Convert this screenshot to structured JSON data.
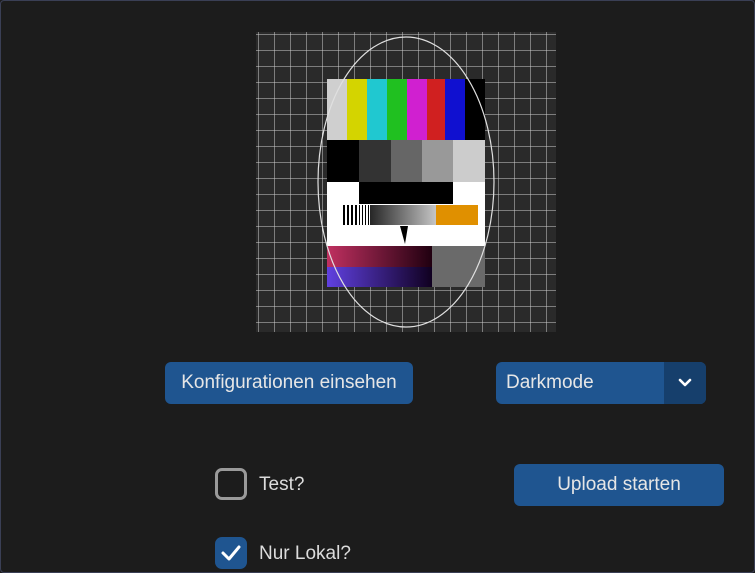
{
  "buttons": {
    "config_label": "Konfigurationen einsehen",
    "upload_label": "Upload starten"
  },
  "theme_select": {
    "selected": "Darkmode",
    "arrow_icon": "chevron-down-icon"
  },
  "checkboxes": {
    "test": {
      "label": "Test?",
      "checked": false
    },
    "local": {
      "label": "Nur Lokal?",
      "checked": true
    }
  },
  "colors": {
    "background": "#1c1c1c",
    "accent": "#1f5590",
    "accent_dark": "#163f6c"
  },
  "testcard": {
    "icon": "tv-test-pattern-image"
  }
}
